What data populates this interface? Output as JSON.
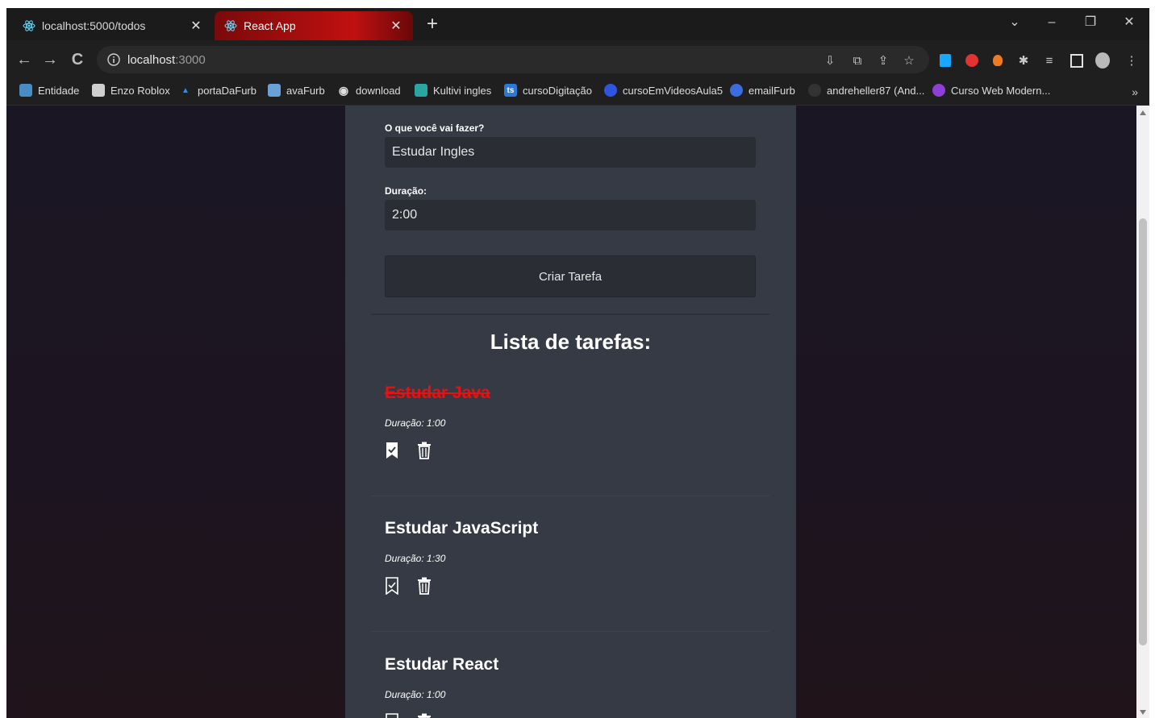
{
  "browser": {
    "tabs": [
      {
        "title": "localhost:5000/todos",
        "active": false
      },
      {
        "title": "React App",
        "active": true
      }
    ],
    "url_host": "localhost",
    "url_port": ":3000",
    "bookmarks": [
      {
        "label": "Entidade"
      },
      {
        "label": "Enzo Roblox"
      },
      {
        "label": "portaDaFurb"
      },
      {
        "label": "avaFurb"
      },
      {
        "label": "download"
      },
      {
        "label": "Kultivi ingles"
      },
      {
        "label": "cursoDigitação"
      },
      {
        "label": "cursoEmVideosAula5"
      },
      {
        "label": "emailFurb"
      },
      {
        "label": "andreheller87 (And..."
      },
      {
        "label": "Curso Web Modern..."
      }
    ],
    "more_bookmarks": "»"
  },
  "form": {
    "title_label": "O que você vai fazer?",
    "title_value": "Estudar Ingles",
    "duration_label": "Duração:",
    "duration_value": "2:00",
    "submit_label": "Criar Tarefa"
  },
  "list": {
    "heading": "Lista de tarefas:",
    "items": [
      {
        "title": "Estudar Java",
        "duration": "Duração: 1:00",
        "done": true
      },
      {
        "title": "Estudar JavaScript",
        "duration": "Duração: 1:30",
        "done": false
      },
      {
        "title": "Estudar React",
        "duration": "Duração: 1:00",
        "done": false
      }
    ]
  },
  "colors": {
    "done_title": "#e81010",
    "panel": "#363a44",
    "active_tab": "#c01010"
  }
}
